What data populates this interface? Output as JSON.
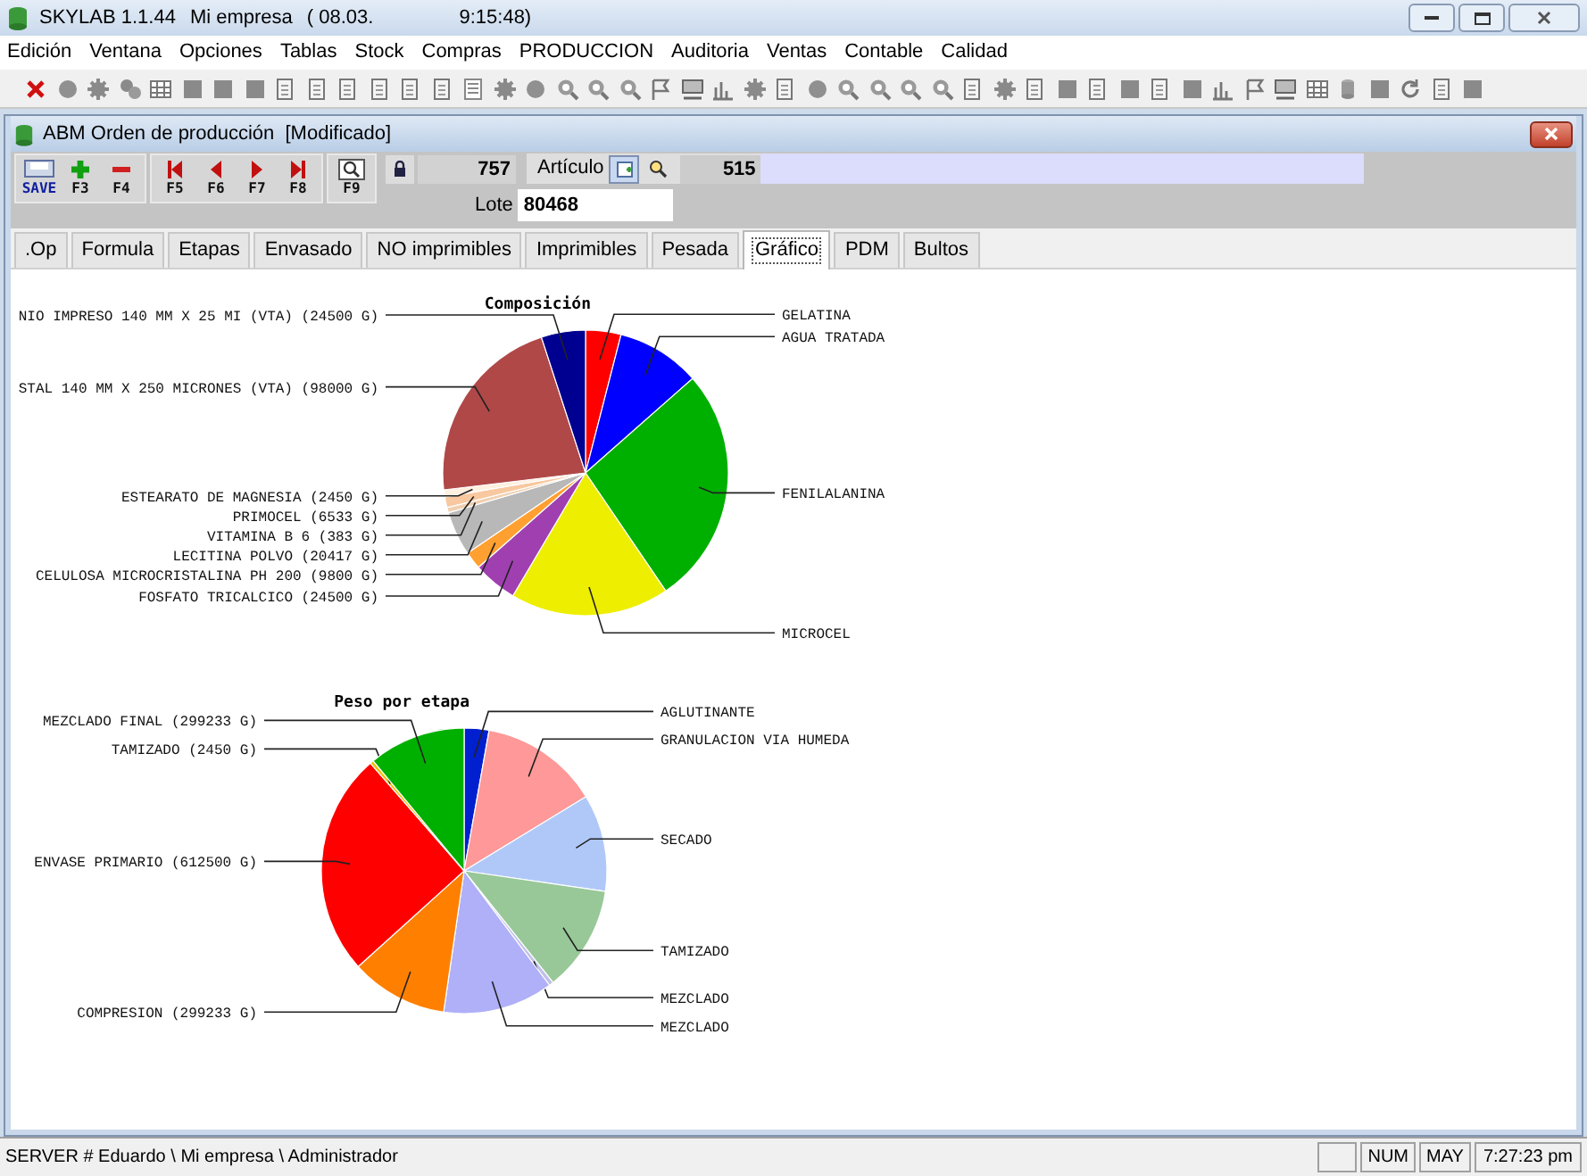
{
  "window": {
    "title_parts": [
      "SKYLAB 1.1.44",
      "Mi empresa",
      "( 08.03.",
      "9:15:48)"
    ]
  },
  "menu": [
    "Edición",
    "Ventana",
    "Opciones",
    "Tablas",
    "Stock",
    "Compras",
    "PRODUCCION",
    "Auditoria",
    "Ventas",
    "Contable",
    "Calidad"
  ],
  "child_window": {
    "title": "ABM Orden de producción  [Modificado]"
  },
  "record_toolbar": {
    "groups": [
      [
        {
          "label": "SAVE",
          "kind": "save"
        },
        {
          "label": "F3",
          "kind": "add"
        },
        {
          "label": "F4",
          "kind": "remove"
        }
      ],
      [
        {
          "label": "F5",
          "kind": "first"
        },
        {
          "label": "F6",
          "kind": "prev"
        },
        {
          "label": "F7",
          "kind": "next"
        },
        {
          "label": "F8",
          "kind": "last"
        }
      ],
      [
        {
          "label": "F9",
          "kind": "search"
        }
      ]
    ]
  },
  "record": {
    "number": "757",
    "articulo_label": "Artículo",
    "articulo": "515",
    "lote_label": "Lote",
    "lote": "80468"
  },
  "tabs": [
    {
      "label": ".Op",
      "selected": false
    },
    {
      "label": "Formula",
      "selected": false
    },
    {
      "label": "Etapas",
      "selected": false
    },
    {
      "label": "Envasado",
      "selected": false
    },
    {
      "label": "NO imprimibles",
      "selected": false
    },
    {
      "label": "Imprimibles",
      "selected": false
    },
    {
      "label": "Pesada",
      "selected": false
    },
    {
      "label": "Gráfico",
      "selected": true
    },
    {
      "label": "PDM",
      "selected": false
    },
    {
      "label": "Bultos",
      "selected": false
    }
  ],
  "charts": [
    {
      "chart_data": {
        "type": "pie",
        "title": "Composición",
        "categories": [
          "GELATINA",
          "AGUA TRATADA",
          "FENILALANINA",
          "MICROCEL",
          "FOSFATO TRICALCICO (24500 G)",
          "CELULOSA MICROCRISTALINA PH 200 (9800 G)",
          "LECITINA POLVO (20417 G)",
          "VITAMINA B 6 (383 G)",
          "PRIMOCEL (6533 G)",
          "ESTEARATO DE MAGNESIA (2450 G)",
          "STAL 140 MM X 250 MICRONES (VTA) (98000 G)",
          "NIO IMPRESO 140 MM X 25 MI (VTA) (24500 G)"
        ],
        "colors": [
          "#ff0000",
          "#0000ff",
          "#00b000",
          "#eeee00",
          "#a040b0",
          "#ffa030",
          "#b8b8b8",
          "#f0d0b0",
          "#f8c8a0",
          "#fff0e0",
          "#b04848",
          "#000090"
        ],
        "values": [
          4,
          9.5,
          27,
          18,
          5,
          2,
          5,
          0.6,
          1.2,
          0.8,
          21.9,
          5
        ]
      }
    },
    {
      "chart_data": {
        "type": "pie",
        "title": "Peso por etapa",
        "categories": [
          "AGLUTINANTE",
          "GRANULACION VIA HUMEDA",
          "SECADO",
          "TAMIZADO",
          "MEZCLADO",
          "MEZCLADO",
          "COMPRESION (299233 G)",
          "ENVASE PRIMARIO (612500 G)",
          "TAMIZADO (2450 G)",
          "MEZCLADO FINAL (299233 G)"
        ],
        "colors": [
          "#0020d0",
          "#ff9898",
          "#b0c8f8",
          "#98c898",
          "#c0c0e8",
          "#b0b0f8",
          "#ff8000",
          "#ff0000",
          "#f0c000",
          "#00b000"
        ],
        "values": [
          2.8,
          13.5,
          11,
          12,
          0.5,
          12.5,
          11,
          25.3,
          0.4,
          11
        ]
      }
    }
  ],
  "status_bar": {
    "text": "SERVER # Eduardo \\ Mi empresa \\ Administrador",
    "indicators": [
      "NUM",
      "MAY"
    ],
    "time": "7:27:23 pm"
  }
}
